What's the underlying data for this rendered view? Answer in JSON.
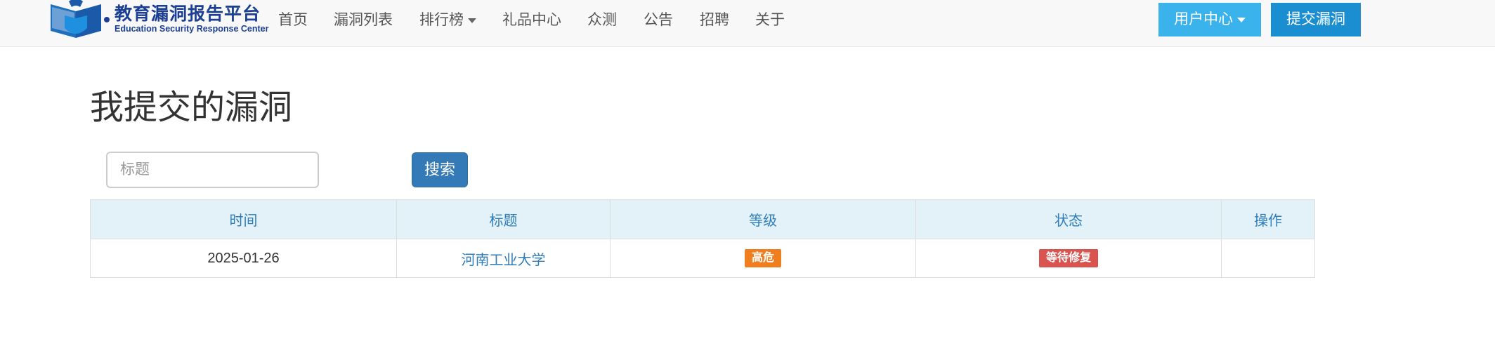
{
  "header": {
    "logo_cn": "教育漏洞报告平台",
    "logo_en": "Education Security Response Center",
    "nav": [
      {
        "label": "首页"
      },
      {
        "label": "漏洞列表"
      },
      {
        "label": "排行榜",
        "dropdown": true
      },
      {
        "label": "礼品中心"
      },
      {
        "label": "众测"
      },
      {
        "label": "公告"
      },
      {
        "label": "招聘"
      },
      {
        "label": "关于"
      }
    ],
    "user_center_label": "用户中心",
    "submit_label": "提交漏洞"
  },
  "page": {
    "title": "我提交的漏洞"
  },
  "search": {
    "placeholder": "标题",
    "value": "",
    "button_label": "搜索"
  },
  "table": {
    "columns": [
      "时间",
      "标题",
      "等级",
      "状态",
      "操作"
    ],
    "rows": [
      {
        "time": "2025-01-26",
        "title": "河南工业大学",
        "level": "高危",
        "status": "等待修复",
        "action": ""
      }
    ]
  },
  "colors": {
    "brand_blue": "#1c3f94",
    "user_center_bg": "#3ab3ec",
    "submit_bg": "#1a8ed0",
    "search_button_bg": "#337ab7",
    "table_header_bg": "#e3f1f9",
    "level_badge": "#f07e1e",
    "status_badge": "#d9534f"
  },
  "icons": {
    "logo": "book-shield-logo-icon",
    "dropdown": "caret-down-icon"
  }
}
